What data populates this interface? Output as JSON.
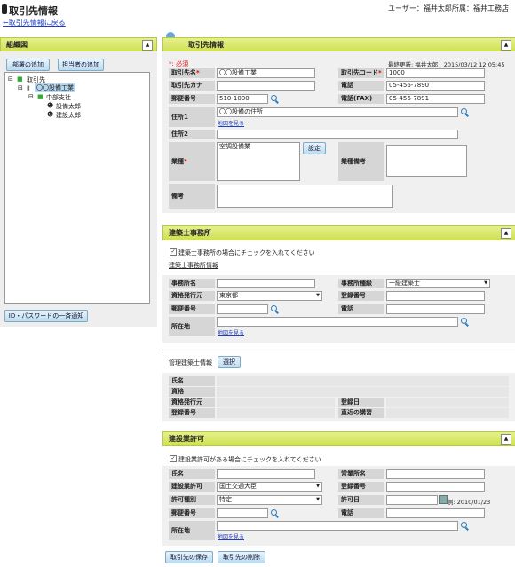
{
  "page": {
    "title": "取引先情報",
    "back_link": "←取引先情報に戻る",
    "user": "ユーザー：福井太郎",
    "dept": "所属：福井工務店"
  },
  "left": {
    "panel_title": "組織図",
    "add_dept": "部署の追加",
    "add_person": "担当者の追加",
    "tree": {
      "root": "取引先",
      "company": "〇〇設備工業",
      "branch": "中部支社",
      "person1": "設備太郎",
      "person2": "建設太郎"
    },
    "notify_button": "ID・パスワードの一斉通知"
  },
  "client": {
    "panel_title": "取引先情報",
    "required_note": "*: 必須",
    "last_update": "最終更新: 福井太郎　2015/03/12 12:05:45",
    "labels": {
      "name": "取引先名",
      "code": "取引先コード",
      "kana": "取引先カナ",
      "tel": "電話",
      "zip": "郵便番号",
      "fax": "電話(FAX)",
      "addr1": "住所1",
      "addr2": "住所2",
      "industry": "業種",
      "industry_note": "業種備考",
      "remarks": "備考"
    },
    "values": {
      "name": "〇〇設備工業",
      "code": "1000",
      "kana": "",
      "tel": "05-456-7890",
      "zip": "510-1000",
      "fax": "05-456-7891",
      "addr1": "〇〇設備の住所",
      "addr2": "",
      "industry": "空調設備業"
    },
    "map_link": "地図を見る",
    "set_button": "設定"
  },
  "architect": {
    "panel_title": "建築士事務所",
    "check_label": "建築士事務所の場合にチェックを入れてください",
    "sub_title": "建築士事務所情報",
    "labels": {
      "office": "事務所名",
      "grade": "事務所種級",
      "issuer": "資格発行元",
      "reg_no": "登録番号",
      "zip": "郵便番号",
      "tel": "電話",
      "addr": "所在地"
    },
    "values": {
      "grade": "一級建築士",
      "issuer": "東京都"
    },
    "map_link": "地図を見る",
    "mgr_title": "管理建築士情報",
    "select_button": "選択",
    "mgr_labels": {
      "name": "氏名",
      "qual": "資格",
      "issuer": "資格発行元",
      "reg_no": "登録番号",
      "reg_date": "登録日",
      "course": "直近の講習"
    }
  },
  "construction": {
    "panel_title": "建設業許可",
    "check_label": "建設業許可がある場合にチェックを入れてください",
    "labels": {
      "name": "氏名",
      "office": "営業所名",
      "permit": "建設業許可",
      "reg_no": "登録番号",
      "type": "許可種別",
      "permit_date": "許可日",
      "zip": "郵便番号",
      "tel": "電話",
      "addr": "所在地"
    },
    "values": {
      "permit": "国土交通大臣",
      "type": "特定"
    },
    "date_hint": "例: 2010/01/23",
    "map_link": "地図を見る"
  },
  "actions": {
    "save": "取引先の保存",
    "delete": "取引先の削除"
  }
}
